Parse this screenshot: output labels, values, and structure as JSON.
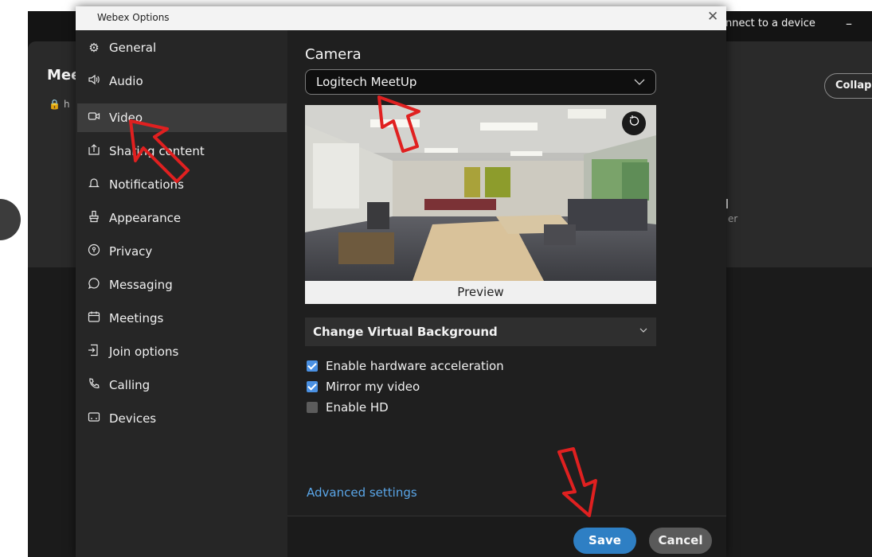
{
  "background_app": {
    "connect_label": "nnect to a device",
    "minimize_glyph": "–",
    "meeting_title": "Mee",
    "meeting_sub_icon": "lock-icon",
    "meeting_sub_text": "h",
    "collapse_label": "Collap",
    "side_text": "er"
  },
  "dialog": {
    "title": "Webex Options",
    "close_glyph": "✕"
  },
  "sidebar": {
    "items": [
      {
        "label": "General",
        "icon": "gear-icon",
        "glyph": "⚙"
      },
      {
        "label": "Audio",
        "icon": "speaker-icon",
        "glyph": "🔈"
      },
      {
        "label": "Video",
        "icon": "video-camera-icon",
        "glyph": "▭",
        "active": true
      },
      {
        "label": "Sharing content",
        "icon": "share-icon",
        "glyph": "⇪"
      },
      {
        "label": "Notifications",
        "icon": "bell-icon",
        "glyph": "🔔"
      },
      {
        "label": "Appearance",
        "icon": "brush-icon",
        "glyph": "✎"
      },
      {
        "label": "Privacy",
        "icon": "privacy-icon",
        "glyph": "◎"
      },
      {
        "label": "Messaging",
        "icon": "chat-bubble-icon",
        "glyph": "◯"
      },
      {
        "label": "Meetings",
        "icon": "calendar-icon",
        "glyph": "▤"
      },
      {
        "label": "Join options",
        "icon": "join-icon",
        "glyph": "⇥"
      },
      {
        "label": "Calling",
        "icon": "phone-icon",
        "glyph": "✆"
      },
      {
        "label": "Devices",
        "icon": "devices-icon",
        "glyph": "▣"
      }
    ]
  },
  "camera": {
    "section_title": "Camera",
    "selected_device": "Logitech MeetUp",
    "preview_label": "Preview",
    "rotate_icon": "rotate-icon"
  },
  "virtual_background": {
    "label": "Change Virtual Background"
  },
  "options": [
    {
      "label": "Enable hardware acceleration",
      "checked": true
    },
    {
      "label": "Mirror my video",
      "checked": true
    },
    {
      "label": "Enable HD",
      "checked": false
    }
  ],
  "advanced_link": "Advanced settings",
  "footer": {
    "save_label": "Save",
    "cancel_label": "Cancel"
  },
  "colors": {
    "accent": "#2e7fc4",
    "link": "#5aa6e8",
    "annotation_arrow": "#e02020"
  }
}
